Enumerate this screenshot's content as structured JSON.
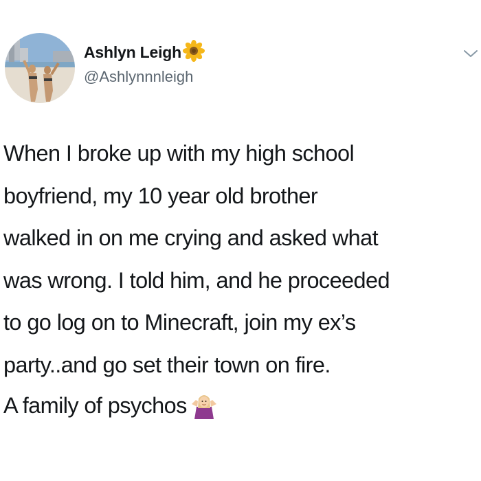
{
  "user": {
    "display_name": "Ashlyn Leigh",
    "handle": "@Ashlynnnleigh",
    "badge_icon": "sunflower-icon"
  },
  "tweet": {
    "lines": [
      "When I broke up with my high school",
      "boyfriend, my 10 year old brother",
      "walked in on me crying and asked what",
      "was wrong. I told him, and he proceeded",
      "to go log on to Minecraft, join my ex’s",
      "party..and go set their town on fire."
    ],
    "closing": "A family of psychos",
    "closing_icon": "person-shrugging-icon"
  },
  "menu_icon": "chevron-down-icon"
}
